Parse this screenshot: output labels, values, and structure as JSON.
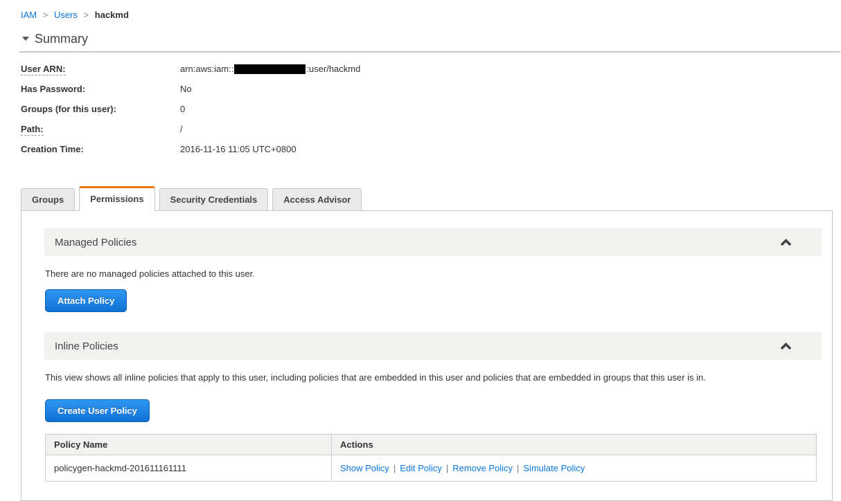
{
  "breadcrumb": {
    "separator": ">",
    "items": [
      "IAM",
      "Users",
      "hackmd"
    ]
  },
  "summary": {
    "title": "Summary",
    "arn": {
      "prefix": "arn:aws:iam::",
      "suffix": ":user/hackmd",
      "redacted_segment": "account-id-hidden"
    },
    "fields": [
      {
        "label": "User ARN:"
      },
      {
        "label": "Has Password:",
        "value": "No"
      },
      {
        "label": "Groups (for this user):",
        "value": "0"
      },
      {
        "label": "Path:",
        "value": "/"
      },
      {
        "label": "Creation Time:",
        "value": "2016-11-16 11:05 UTC+0800"
      }
    ]
  },
  "tabs": [
    {
      "label": "Groups",
      "active": false
    },
    {
      "label": "Permissions",
      "active": true
    },
    {
      "label": "Security Credentials",
      "active": false
    },
    {
      "label": "Access Advisor",
      "active": false
    }
  ],
  "managed_policies": {
    "title": "Managed Policies",
    "empty_message": "There are no managed policies attached to this user.",
    "attach_button": "Attach Policy"
  },
  "inline_policies": {
    "title": "Inline Policies",
    "description": "This view shows all inline policies that apply to this user, including policies that are embedded in this user and policies that are embedded in groups that this user is in.",
    "create_button": "Create User Policy",
    "actions_separator": "|",
    "table": {
      "headers": [
        "Policy Name",
        "Actions"
      ],
      "rows": [
        {
          "policy_name": "policygen-hackmd-201611161111",
          "actions": [
            "Show Policy",
            "Edit Policy",
            "Remove Policy",
            "Simulate Policy"
          ]
        }
      ]
    }
  },
  "colors": {
    "link_blue": "#0b76dd",
    "tab_active_accent": "#e8770d",
    "button_blue_top": "#3097f3",
    "button_blue_bottom": "#0e71d3",
    "section_header_bg": "#f1f1f0"
  }
}
